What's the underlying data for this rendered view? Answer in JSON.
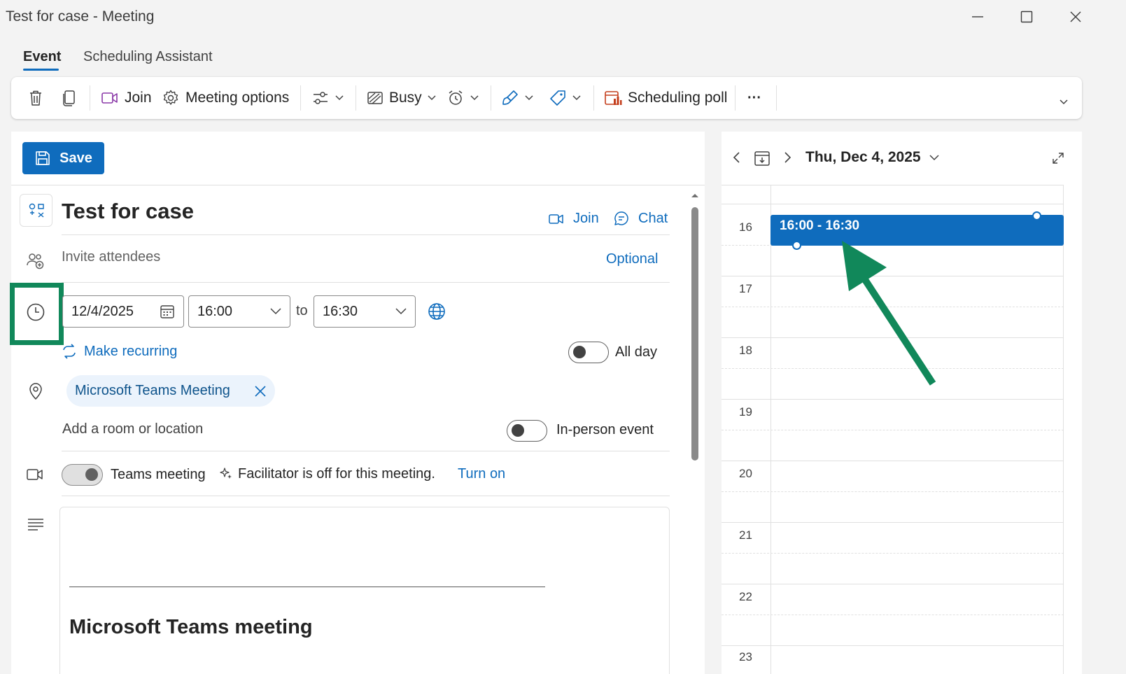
{
  "window": {
    "title": "Test for case - Meeting"
  },
  "tabs": [
    {
      "label": "Event",
      "active": true
    },
    {
      "label": "Scheduling Assistant",
      "active": false
    }
  ],
  "ribbon": {
    "join_label": "Join",
    "meeting_options_label": "Meeting options",
    "busy_label": "Busy",
    "scheduling_poll_label": "Scheduling poll",
    "more_label": "···"
  },
  "form": {
    "save_label": "Save",
    "title_value": "Test for case",
    "join_label": "Join",
    "chat_label": "Chat",
    "attendees_placeholder": "Invite attendees",
    "optional_label": "Optional",
    "date_value": "12/4/2025",
    "start_time": "16:00",
    "to_label": "to",
    "end_time": "16:30",
    "make_recurring_label": "Make recurring",
    "all_day_label": "All day",
    "location_chip": "Microsoft Teams Meeting",
    "room_placeholder": "Add a room or location",
    "in_person_label": "In-person event",
    "teams_meeting_label": "Teams meeting",
    "facilitator_text": "Facilitator is off for this meeting.",
    "turn_on_label": "Turn on",
    "body_separator": "________________________________________________________________________________",
    "body_heading": "Microsoft Teams meeting"
  },
  "calendar": {
    "date_label": "Thu, Dec 4, 2025",
    "hours": [
      "16",
      "17",
      "18",
      "19",
      "20",
      "21",
      "22",
      "23"
    ],
    "event_label": "16:00 - 16:30"
  },
  "colors": {
    "accent": "#0f6cbd",
    "highlight_box": "#11885a",
    "arrow": "#11885a"
  }
}
